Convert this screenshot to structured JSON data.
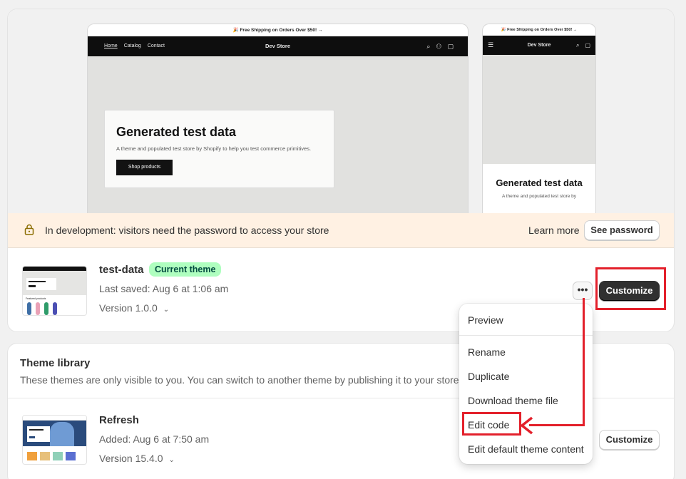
{
  "preview": {
    "announcement": "🎉 Free Shipping on Orders Over $50! →",
    "store_name": "Dev Store",
    "nav_links": [
      "Home",
      "Catalog",
      "Contact"
    ],
    "hero_title": "Generated test data",
    "hero_subtitle": "A theme and populated test store by Shopify to help you test commerce primitives.",
    "hero_button": "Shop products",
    "mobile_title": "Generated test data",
    "mobile_subtitle": "A theme and populated test store by"
  },
  "dev_banner": {
    "message": "In development: visitors need the password to access your store",
    "learn_more": "Learn more",
    "see_password": "See password"
  },
  "current_theme": {
    "name": "test-data",
    "badge": "Current theme",
    "last_saved": "Last saved: Aug 6 at 1:06 am",
    "version": "Version 1.0.0",
    "more_label": "•••",
    "customize": "Customize",
    "thumb_label": "Featured products"
  },
  "library": {
    "title": "Theme library",
    "subtitle": "These themes are only visible to you. You can switch to another theme by publishing it to your store.",
    "themes": [
      {
        "name": "Refresh",
        "added": "Added: Aug 6 at 7:50 am",
        "version": "Version 15.4.0",
        "customize": "Customize"
      }
    ]
  },
  "menu": {
    "items": [
      "Preview",
      "Rename",
      "Duplicate",
      "Download theme file",
      "Edit code",
      "Edit default theme content"
    ]
  },
  "colors": {
    "annotation": "#e3202b",
    "badge_bg": "#affebf",
    "banner_bg": "#fff1e3"
  }
}
